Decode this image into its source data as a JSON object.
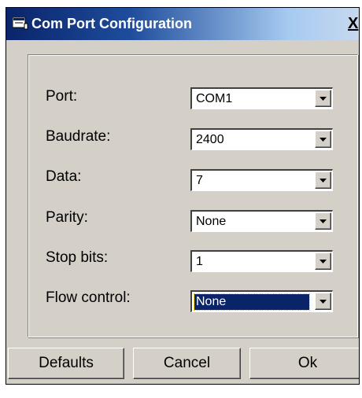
{
  "window": {
    "title": "Com Port Configuration",
    "close_label": "X"
  },
  "fields": [
    {
      "label": "Port:",
      "value": "COM1",
      "selected": false
    },
    {
      "label": "Baudrate:",
      "value": "2400",
      "selected": false
    },
    {
      "label": "Data:",
      "value": "7",
      "selected": false
    },
    {
      "label": "Parity:",
      "value": "None",
      "selected": false
    },
    {
      "label": "Stop bits:",
      "value": "1",
      "selected": false
    },
    {
      "label": "Flow control:",
      "value": "None",
      "selected": true
    }
  ],
  "buttons": {
    "defaults": "Defaults",
    "cancel": "Cancel",
    "ok": "Ok"
  },
  "colors": {
    "titlebar_start": "#0a246a",
    "titlebar_end": "#a6caf0",
    "face": "#d4d0c8",
    "selection": "#0a246a"
  },
  "icons": {
    "app": "app-window-icon",
    "dropdown": "chevron-down-icon"
  }
}
